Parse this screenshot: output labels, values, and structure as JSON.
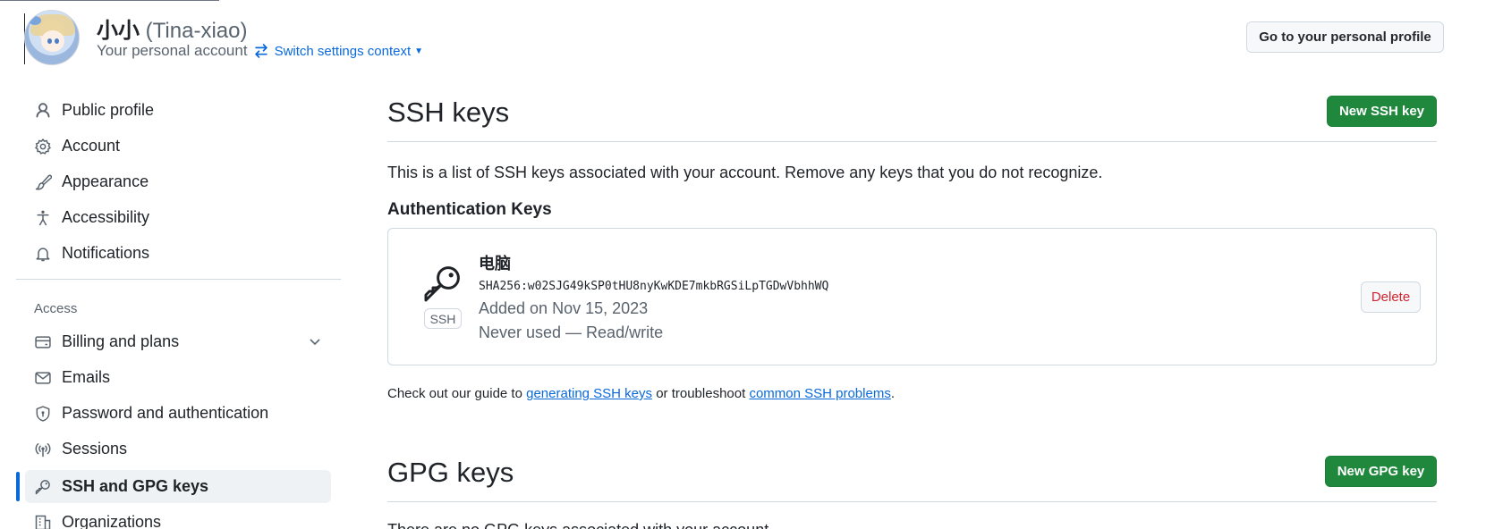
{
  "header": {
    "display_name": "小小",
    "username": "(Tina-xiao)",
    "account_type": "Your personal account",
    "switch_context_label": "Switch settings context",
    "profile_button_label": "Go to your personal profile"
  },
  "sidebar": {
    "items_top": [
      {
        "label": "Public profile",
        "icon": "person-icon"
      },
      {
        "label": "Account",
        "icon": "gear-icon"
      },
      {
        "label": "Appearance",
        "icon": "paintbrush-icon"
      },
      {
        "label": "Accessibility",
        "icon": "accessibility-icon"
      },
      {
        "label": "Notifications",
        "icon": "bell-icon"
      }
    ],
    "access_heading": "Access",
    "items_access": [
      {
        "label": "Billing and plans",
        "icon": "credit-card-icon"
      },
      {
        "label": "Emails",
        "icon": "mail-icon"
      },
      {
        "label": "Password and authentication",
        "icon": "shield-lock-icon"
      },
      {
        "label": "Sessions",
        "icon": "broadcast-icon"
      },
      {
        "label": "SSH and GPG keys",
        "icon": "key-icon",
        "active": true
      },
      {
        "label": "Organizations",
        "icon": "organization-icon"
      }
    ]
  },
  "ssh": {
    "title": "SSH keys",
    "new_button_label": "New SSH key",
    "description": "This is a list of SSH keys associated with your account. Remove any keys that you do not recognize.",
    "auth_heading": "Authentication Keys",
    "key": {
      "badge": "SSH",
      "title": "电脑",
      "fingerprint": "SHA256:w02SJG49kSP0tHU8nyKwKDE7mkbRGSiLpTGDwVbhhWQ",
      "added": "Added on Nov 15, 2023",
      "usage": "Never used — Read/write",
      "delete_label": "Delete"
    },
    "guide": {
      "prefix": "Check out our guide to ",
      "link1": "generating SSH keys",
      "middle": " or troubleshoot ",
      "link2": "common SSH problems",
      "suffix": "."
    }
  },
  "gpg": {
    "title": "GPG keys",
    "new_button_label": "New GPG key",
    "description": "There are no GPG keys associated with your account."
  },
  "colors": {
    "primary_green": "#1f883d",
    "link_blue": "#0969da",
    "danger_red": "#d1242f",
    "border": "#d1d9e0"
  }
}
